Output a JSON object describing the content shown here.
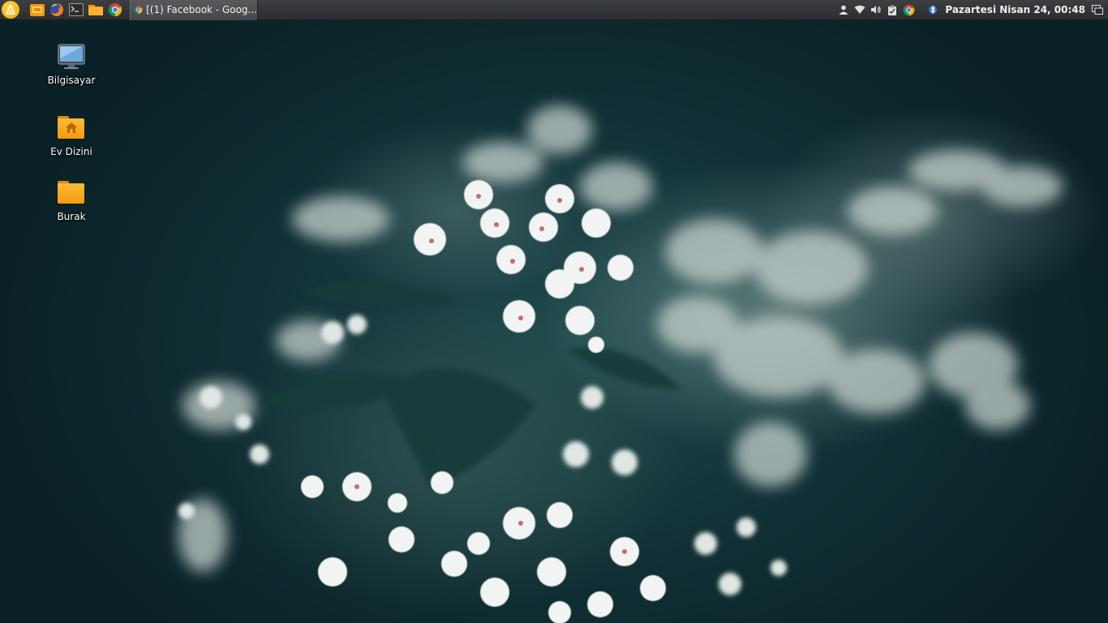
{
  "panel": {
    "menu_icon": "system-menu-icon",
    "launchers": [
      {
        "name": "file-manager-launcher",
        "icon": "file-manager-icon"
      },
      {
        "name": "firefox-launcher",
        "icon": "firefox-icon"
      },
      {
        "name": "terminal-launcher",
        "icon": "terminal-icon"
      },
      {
        "name": "folder-launcher",
        "icon": "folder-icon"
      },
      {
        "name": "chrome-launcher",
        "icon": "chrome-icon"
      }
    ],
    "task": {
      "title": "[(1) Facebook - Goog...",
      "icon": "chrome-icon"
    },
    "clock": "Pazartesi Nisan 24, 00:48",
    "colors": {
      "panel_bg": "#2b2d30",
      "menu_accent": "#f0a800",
      "folder_orange": "#f39a0c"
    }
  },
  "desktop": {
    "icons": [
      {
        "label": "Bilgisayar",
        "icon": "computer-icon"
      },
      {
        "label": "Ev Dizini",
        "icon": "home-folder-icon"
      },
      {
        "label": "Burak",
        "icon": "folder-icon"
      }
    ]
  }
}
